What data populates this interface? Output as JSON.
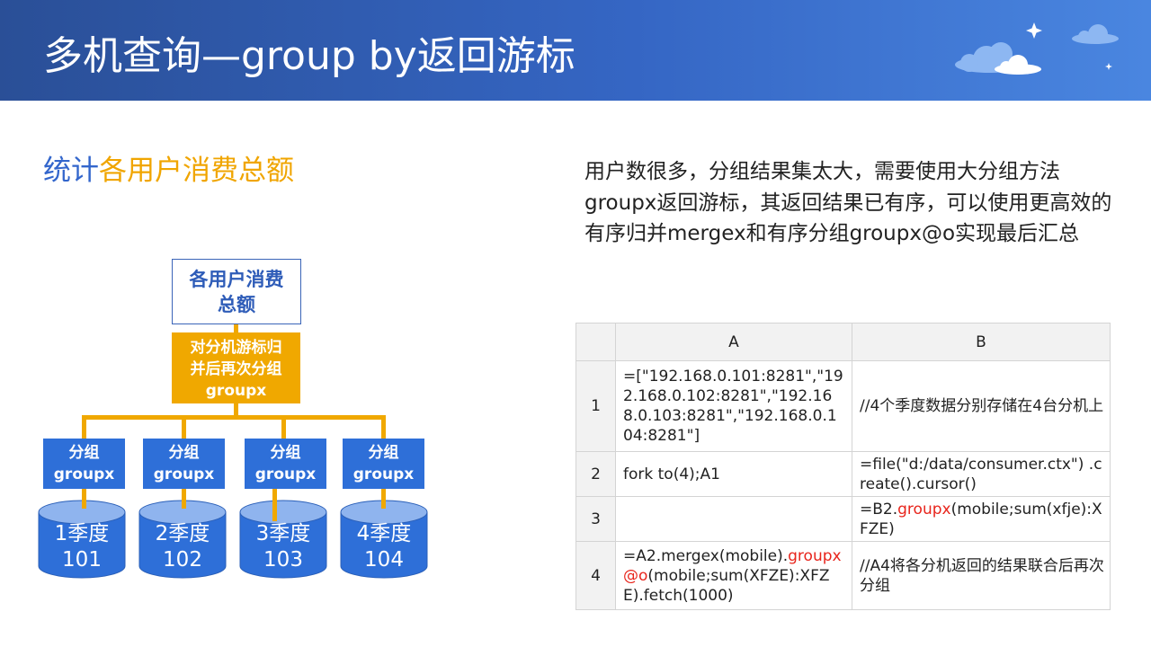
{
  "header": {
    "title": "多机查询—group by返回游标"
  },
  "subtitle": {
    "part1": "统计",
    "part2": "各用户消费总额",
    "part1_color": "#3366cc",
    "part2_color": "#f0a500"
  },
  "description": "用户数很多，分组结果集太大，需要使用大分组方法groupx返回游标，其返回结果已有序，可以使用更高效的有序归并mergex和有序分组groupx@o实现最后汇总",
  "diagram": {
    "top_node": {
      "line1": "各用户消费",
      "line2": "总额"
    },
    "merge_node": {
      "line1": "对分机游标归",
      "line2": "并后再次分组",
      "line3": "groupx"
    },
    "group_nodes": [
      {
        "line1": "分组",
        "line2": "groupx"
      },
      {
        "line1": "分组",
        "line2": "groupx"
      },
      {
        "line1": "分组",
        "line2": "groupx"
      },
      {
        "line1": "分组",
        "line2": "groupx"
      }
    ],
    "databases": [
      {
        "line1": "1季度",
        "line2": "101"
      },
      {
        "line1": "2季度",
        "line2": "102"
      },
      {
        "line1": "3季度",
        "line2": "103"
      },
      {
        "line1": "4季度",
        "line2": "104"
      }
    ],
    "colors": {
      "accent": "#f0a800",
      "node_blue": "#2e6fd8",
      "title_blue": "#2e5cb8"
    }
  },
  "sheet": {
    "columns": [
      "A",
      "B"
    ],
    "rows": [
      {
        "num": "1",
        "a": "=[\"192.168.0.101:8281\",\"192.168.0.102:8281\",\"192.168.0.103:8281\",\"192.168.0.104:8281\"]",
        "b": "//4个季度数据分别存储在4台分机上"
      },
      {
        "num": "2",
        "a": "fork to(4);A1",
        "b": "=file(\"d:/data/consumer.ctx\") .create().cursor()"
      },
      {
        "num": "3",
        "a": "",
        "b_pre": "=B2.",
        "b_red": "groupx",
        "b_post": "(mobile;sum(xfje):XFZE)"
      },
      {
        "num": "4",
        "a_pre": "=A2.mergex(mobile).",
        "a_red": "groupx@o",
        "a_post": "(mobile;sum(XFZE):XFZE).fetch(1000)",
        "b": "//A4将各分机返回的结果联合后再次分组"
      }
    ],
    "highlight_color": "#e8251c"
  }
}
